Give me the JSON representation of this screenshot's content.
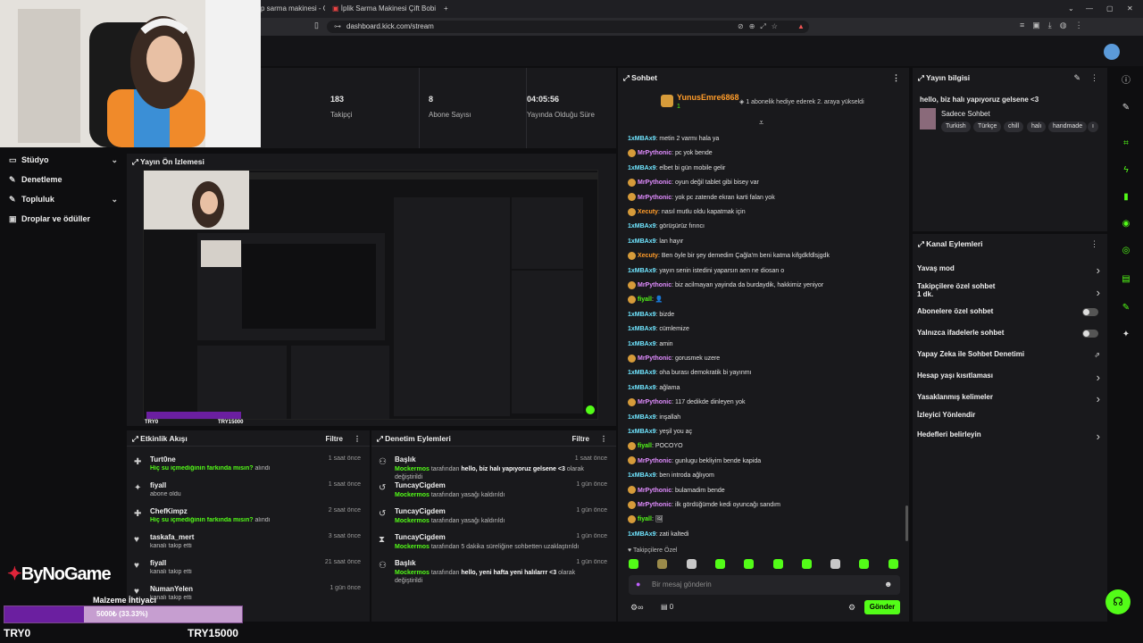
{
  "browser": {
    "tabs": [
      {
        "label": "p sarma makinesi - Googl"
      },
      {
        "label": "İplik Sarma Makinesi Çift Bobin / M3"
      }
    ],
    "url": "dashboard.kick.com/stream"
  },
  "sidebar": {
    "items": [
      {
        "label": "Stüdyo",
        "icon": "video-icon",
        "expandable": true
      },
      {
        "label": "Denetleme",
        "icon": "wrench-icon",
        "expandable": false
      },
      {
        "label": "Topluluk",
        "icon": "people-icon",
        "expandable": true
      },
      {
        "label": "Droplar ve ödüller",
        "icon": "gift-icon",
        "expandable": false
      }
    ]
  },
  "stats": {
    "followers": {
      "value": "183",
      "label": "Takipçi"
    },
    "subscribers": {
      "value": "8",
      "label": "Abone Sayısı"
    },
    "uptime": {
      "value": "04:05:56",
      "label": "Yayında Olduğu Süre"
    }
  },
  "preview": {
    "title": "Yayın Ön İzlemesi"
  },
  "activity": {
    "title": "Etkinlik Akışı",
    "filter": "Filtre",
    "rows": [
      {
        "name": "Turt0ne",
        "sub_green": "Hiç su içmediğinin farkında mısın?",
        "sub": " alındı",
        "time": "1 saat önce",
        "icon": "gift-icon"
      },
      {
        "name": "fiyall",
        "sub_green": "",
        "sub": "abone oldu",
        "time": "1 saat önce",
        "icon": "star-icon"
      },
      {
        "name": "ChefKimpz",
        "sub_green": "Hiç su içmediğinin farkında mısın?",
        "sub": " alındı",
        "time": "2 saat önce",
        "icon": "gift-icon"
      },
      {
        "name": "taskafa_mert",
        "sub_green": "",
        "sub": "kanalı takip etti",
        "time": "3 saat önce",
        "icon": "heart-icon"
      },
      {
        "name": "fiyall",
        "sub_green": "",
        "sub": "kanalı takip etti",
        "time": "21 saat önce",
        "icon": "heart-icon"
      },
      {
        "name": "NumanYelen",
        "sub_green": "",
        "sub": "kanalı takip etti",
        "time": "1 gün önce",
        "icon": "heart-icon"
      }
    ]
  },
  "moderation": {
    "title": "Denetim Eylemleri",
    "filter": "Filtre",
    "rows": [
      {
        "name": "Başlık",
        "actor": "Mockermos",
        "sub": " tarafından ",
        "detail": "hello, biz halı yapıyoruz gelsene <3",
        "tail": " olarak değiştirildi",
        "time": "1 saat önce",
        "icon": "person-icon"
      },
      {
        "name": "TuncayCigdem",
        "actor": "Mockermos",
        "sub": " tarafından yasağı kaldırıldı",
        "detail": "",
        "tail": "",
        "time": "1 gün önce",
        "icon": "undo-icon"
      },
      {
        "name": "TuncayCigdem",
        "actor": "Mockermos",
        "sub": " tarafından yasağı kaldırıldı",
        "detail": "",
        "tail": "",
        "time": "1 gün önce",
        "icon": "undo-icon"
      },
      {
        "name": "TuncayCigdem",
        "actor": "Mockermos",
        "sub": " tarafından 5 dakika süreliğine sohbetten uzaklaştırıldı",
        "detail": "",
        "tail": "",
        "time": "1 gün önce",
        "icon": "hourglass-icon"
      },
      {
        "name": "Başlık",
        "actor": "Mockermos",
        "sub": " tarafından ",
        "detail": "hello, yeni hafta yeni halılarrr <3",
        "tail": " olarak değiştirildi",
        "time": "1 gün önce",
        "icon": "person-icon"
      }
    ]
  },
  "chat": {
    "title": "Sohbet",
    "pinned_user": "YunusEmre6868",
    "pinned_count": "1",
    "pinned_note": "1 abonelik hediye ederek 2. araya yükseldi",
    "messages": [
      {
        "user": "1xMBAx9",
        "color": "blue",
        "badge": false,
        "text": "metin 2 varmı hala ya"
      },
      {
        "user": "MrPythonic",
        "color": "mag",
        "badge": true,
        "text": "pc yok bende"
      },
      {
        "user": "1xMBAx9",
        "color": "blue",
        "badge": false,
        "text": "elbet bi gün mobile gelir"
      },
      {
        "user": "MrPythonic",
        "color": "mag",
        "badge": true,
        "text": "oyun değil tablet gibi bisey var"
      },
      {
        "user": "MrPythonic",
        "color": "mag",
        "badge": true,
        "text": "yok pc zatende ekran karti falan yok"
      },
      {
        "user": "Xecuty",
        "color": "orange",
        "badge": true,
        "text": "nasıl mutlu oldu kapatmak için"
      },
      {
        "user": "1xMBAx9",
        "color": "blue",
        "badge": false,
        "text": "görüşürüz fırıncı"
      },
      {
        "user": "1xMBAx9",
        "color": "blue",
        "badge": false,
        "text": "lan hayır"
      },
      {
        "user": "Xecuty",
        "color": "orange",
        "badge": true,
        "text": "Ben öyle bir şey demedim Çağla'm beni katma kifgdkfdlsjgdk"
      },
      {
        "user": "1xMBAx9",
        "color": "blue",
        "badge": false,
        "text": "yayın senin istedini yaparsın aen ne diosan o"
      },
      {
        "user": "MrPythonic",
        "color": "mag",
        "badge": true,
        "text": "biz acilmayan yayinda da burdaydik, hakkimiz yeniyor"
      },
      {
        "user": "fiyall",
        "color": "green",
        "badge": true,
        "text": "👤"
      },
      {
        "user": "1xMBAx9",
        "color": "blue",
        "badge": false,
        "text": "bizde"
      },
      {
        "user": "1xMBAx9",
        "color": "blue",
        "badge": false,
        "text": "cümlemize"
      },
      {
        "user": "1xMBAx9",
        "color": "blue",
        "badge": false,
        "text": "amin"
      },
      {
        "user": "MrPythonic",
        "color": "mag",
        "badge": true,
        "text": "gorusmek uzere"
      },
      {
        "user": "1xMBAx9",
        "color": "blue",
        "badge": false,
        "text": "oha burası demokratik bi yayınmı"
      },
      {
        "user": "1xMBAx9",
        "color": "blue",
        "badge": false,
        "text": "ağlama"
      },
      {
        "user": "MrPythonic",
        "color": "mag",
        "badge": true,
        "text": "117 dedikde dinleyen yok"
      },
      {
        "user": "1xMBAx9",
        "color": "blue",
        "badge": false,
        "text": "inşallah"
      },
      {
        "user": "1xMBAx9",
        "color": "blue",
        "badge": false,
        "text": "yeşil you aç"
      },
      {
        "user": "fiyall",
        "color": "green",
        "badge": true,
        "text": "POCOYO"
      },
      {
        "user": "MrPythonic",
        "color": "mag",
        "badge": true,
        "text": "gunlugu bekliyim bende kapida"
      },
      {
        "user": "1xMBAx9",
        "color": "blue",
        "badge": false,
        "text": "ben introda ağlıyom"
      },
      {
        "user": "MrPythonic",
        "color": "mag",
        "badge": true,
        "text": "bulamadim bende"
      },
      {
        "user": "MrPythonic",
        "color": "mag",
        "badge": true,
        "text": "ilk gördüğümde kedi oyuncağı sandım"
      },
      {
        "user": "fiyall",
        "color": "green",
        "badge": true,
        "text": "🖼"
      },
      {
        "user": "1xMBAx9",
        "color": "blue",
        "badge": false,
        "text": "zati kaltedi"
      }
    ],
    "emote_bar_label": "Takipçilere Özel",
    "input_placeholder": "Bir mesaj gönderin",
    "send_label": "Gönder",
    "footer_count": "0"
  },
  "info": {
    "title": "Yayın bilgisi",
    "stream_title": "hello, biz halı yapıyoruz gelsene <3",
    "category": "Sadece Sohbet",
    "tags": [
      "Turkish",
      "Türkçe",
      "chill",
      "halı",
      "handmade",
      "ı"
    ]
  },
  "actions": {
    "title": "Kanal Eylemleri",
    "items": [
      {
        "label": "Yavaş mod",
        "control": "chevron",
        "sub": ""
      },
      {
        "label": "Takipçilere özel sohbet",
        "control": "chevron",
        "sub": "1 dk."
      },
      {
        "label": "Abonelere özel sohbet",
        "control": "toggle",
        "sub": ""
      },
      {
        "label": "Yalnızca ifadelerle sohbet",
        "control": "toggle",
        "sub": ""
      },
      {
        "label": "Yapay Zeka ile Sohbet Denetimi",
        "control": "external",
        "sub": ""
      },
      {
        "label": "Hesap yaşı kısıtlaması",
        "control": "chevron",
        "sub": ""
      },
      {
        "label": "Yasaklanmış kelimeler",
        "control": "chevron",
        "sub": ""
      },
      {
        "label": "İzleyici Yönlendir",
        "control": "none",
        "sub": ""
      },
      {
        "label": "Hedefleri belirleyin",
        "control": "chevron",
        "sub": ""
      }
    ]
  },
  "overlay": {
    "logo": "ByNoGame",
    "goal_label": "Malzeme İhtiyacı",
    "goal_text": "5000₺ (33.33%)",
    "goal_progress": 0.3333,
    "goal_min": "TRY0",
    "goal_max": "TRY15000"
  },
  "colors": {
    "accent": "#53fc18",
    "panel": "#19191c",
    "bg": "#0e0e10"
  }
}
